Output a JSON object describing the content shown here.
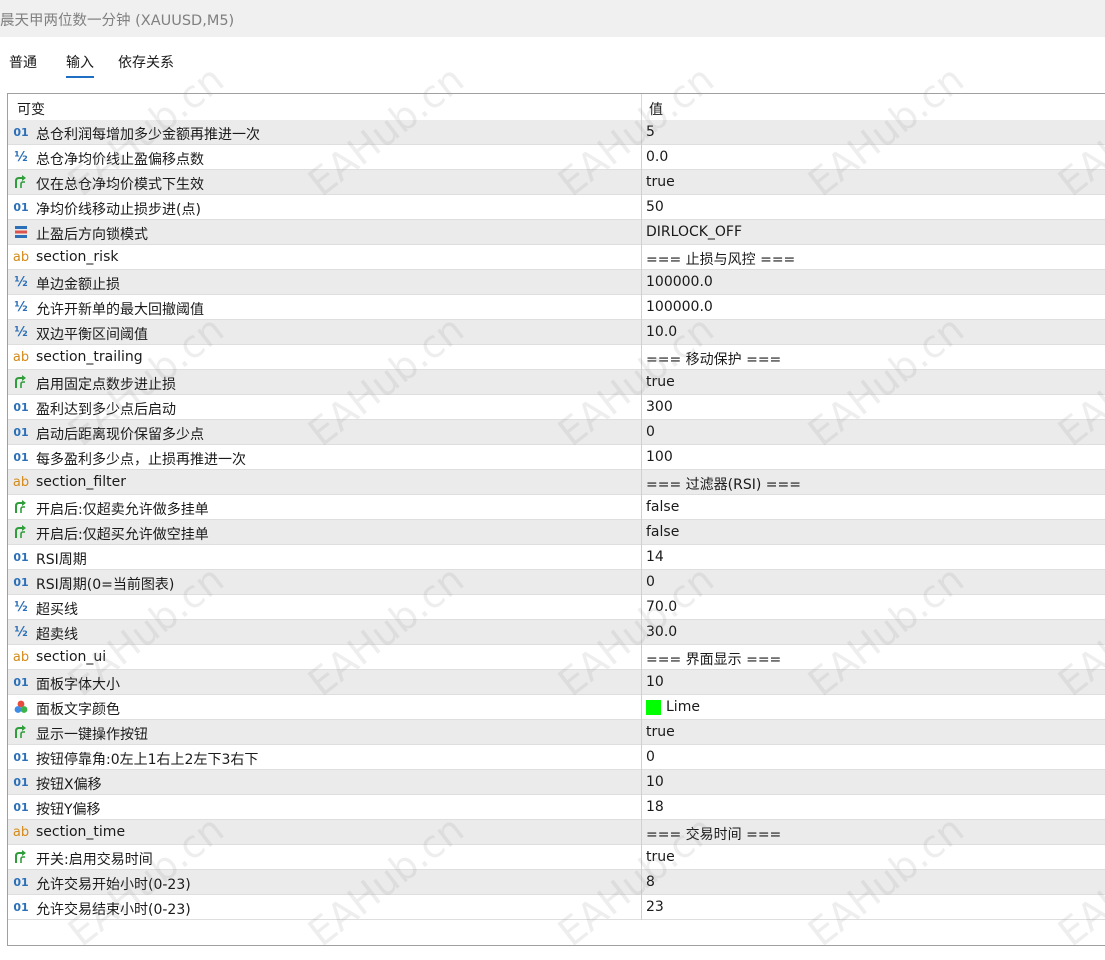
{
  "window": {
    "title": "晨天甲两位数一分钟   (XAUUSD,M5)"
  },
  "tabs": [
    {
      "label": "普通",
      "active": false
    },
    {
      "label": "输入",
      "active": true
    },
    {
      "label": "依存关系",
      "active": false
    }
  ],
  "table": {
    "headers": {
      "name": "可变",
      "value": "值"
    },
    "rows": [
      {
        "icon": "int-icon",
        "name": "总仓利润每增加多少金额再推进一次",
        "value": "5"
      },
      {
        "icon": "double-icon",
        "name": "总仓净均价线止盈偏移点数",
        "value": "0.0"
      },
      {
        "icon": "bool-icon",
        "name": "仅在总仓净均价模式下生效",
        "value": "true"
      },
      {
        "icon": "int-icon",
        "name": "净均价线移动止损步进(点)",
        "value": "50"
      },
      {
        "icon": "enum-icon",
        "name": "止盈后方向锁模式",
        "value": "DIRLOCK_OFF"
      },
      {
        "icon": "string-icon",
        "name": "section_risk",
        "value": "=== 止损与风控 ==="
      },
      {
        "icon": "double-icon",
        "name": "单边金额止损",
        "value": "100000.0"
      },
      {
        "icon": "double-icon",
        "name": "允许开新单的最大回撤阈值",
        "value": "100000.0"
      },
      {
        "icon": "double-icon",
        "name": "双边平衡区间阈值",
        "value": "10.0"
      },
      {
        "icon": "string-icon",
        "name": "section_trailing",
        "value": "=== 移动保护 ==="
      },
      {
        "icon": "bool-icon",
        "name": "启用固定点数步进止损",
        "value": "true"
      },
      {
        "icon": "int-icon",
        "name": "盈利达到多少点后启动",
        "value": "300"
      },
      {
        "icon": "int-icon",
        "name": "启动后距离现价保留多少点",
        "value": "0"
      },
      {
        "icon": "int-icon",
        "name": "每多盈利多少点，止损再推进一次",
        "value": "100"
      },
      {
        "icon": "string-icon",
        "name": "section_filter",
        "value": "=== 过滤器(RSI) ==="
      },
      {
        "icon": "bool-icon",
        "name": "开启后:仅超卖允许做多挂单",
        "value": "false"
      },
      {
        "icon": "bool-icon",
        "name": "开启后:仅超买允许做空挂单",
        "value": "false"
      },
      {
        "icon": "int-icon",
        "name": "RSI周期",
        "value": "14"
      },
      {
        "icon": "int-icon",
        "name": "RSI周期(0=当前图表)",
        "value": "0"
      },
      {
        "icon": "double-icon",
        "name": "超买线",
        "value": "70.0"
      },
      {
        "icon": "double-icon",
        "name": "超卖线",
        "value": "30.0"
      },
      {
        "icon": "string-icon",
        "name": "section_ui",
        "value": "=== 界面显示 ==="
      },
      {
        "icon": "int-icon",
        "name": "面板字体大小",
        "value": "10"
      },
      {
        "icon": "color-icon",
        "name": "面板文字颜色",
        "value": "Lime",
        "swatch": "#00ff00"
      },
      {
        "icon": "bool-icon",
        "name": "显示一键操作按钮",
        "value": "true"
      },
      {
        "icon": "int-icon",
        "name": "按钮停靠角:0左上1右上2左下3右下",
        "value": "0"
      },
      {
        "icon": "int-icon",
        "name": "按钮X偏移",
        "value": "10"
      },
      {
        "icon": "int-icon",
        "name": "按钮Y偏移",
        "value": "18"
      },
      {
        "icon": "string-icon",
        "name": "section_time",
        "value": "=== 交易时间 ==="
      },
      {
        "icon": "bool-icon",
        "name": "开关:启用交易时间",
        "value": "true"
      },
      {
        "icon": "int-icon",
        "name": "允许交易开始小时(0-23)",
        "value": "8"
      },
      {
        "icon": "int-icon",
        "name": "允许交易结束小时(0-23)",
        "value": "23"
      }
    ]
  },
  "colors": {
    "accent": "#1e6fc4",
    "row_alt": "#ebebeb",
    "int_icon": "#2a6fb8",
    "string_icon": "#d48a1a",
    "bool_icon": "#2e9e3a"
  },
  "watermark": "EAHub.cn"
}
